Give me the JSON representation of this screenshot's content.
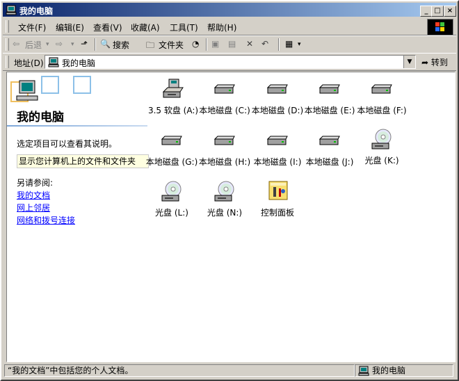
{
  "window": {
    "title": "我的电脑"
  },
  "title_buttons": {
    "minimize": "_",
    "maximize": "□",
    "close": "×"
  },
  "menu": [
    {
      "label": "文件(F)"
    },
    {
      "label": "编辑(E)"
    },
    {
      "label": "查看(V)"
    },
    {
      "label": "收藏(A)"
    },
    {
      "label": "工具(T)"
    },
    {
      "label": "帮助(H)"
    }
  ],
  "toolbar": {
    "back_label": "后退",
    "search_label": "搜索",
    "folders_label": "文件夹"
  },
  "address": {
    "label": "地址(D)",
    "value": "我的电脑",
    "go_label": "转到"
  },
  "left_pane": {
    "title": "我的电脑",
    "description": "选定项目可以查看其说明。",
    "tip": "显示您计算机上的文件和文件夹",
    "see_also_label": "另请参阅:",
    "links": [
      "我的文档",
      "网上邻居",
      "网络和拨号连接"
    ]
  },
  "items": [
    {
      "label": "3.5 软盘 (A:)",
      "icon": "floppy-drive-icon"
    },
    {
      "label": "本地磁盘 (C:)",
      "icon": "hard-drive-icon"
    },
    {
      "label": "本地磁盘 (D:)",
      "icon": "hard-drive-icon"
    },
    {
      "label": "本地磁盘 (E:)",
      "icon": "hard-drive-icon"
    },
    {
      "label": "本地磁盘 (F:)",
      "icon": "hard-drive-icon"
    },
    {
      "label": "本地磁盘 (G:)",
      "icon": "hard-drive-icon"
    },
    {
      "label": "本地磁盘 (H:)",
      "icon": "hard-drive-icon"
    },
    {
      "label": "本地磁盘 (I:)",
      "icon": "hard-drive-icon"
    },
    {
      "label": "本地磁盘 (J:)",
      "icon": "hard-drive-icon"
    },
    {
      "label": "光盘 (K:)",
      "icon": "cd-drive-icon"
    },
    {
      "label": "光盘 (L:)",
      "icon": "cd-drive-icon"
    },
    {
      "label": "光盘 (N:)",
      "icon": "cd-drive-icon"
    },
    {
      "label": "控制面板",
      "icon": "control-panel-icon"
    }
  ],
  "status": {
    "left": "“我的文档”中包括您的个人文档。",
    "right": "我的电脑"
  },
  "colors": {
    "title_start": "#0a246a",
    "title_end": "#a6caf0",
    "link": "#0000ff",
    "tip_bg": "#ffffe1"
  }
}
